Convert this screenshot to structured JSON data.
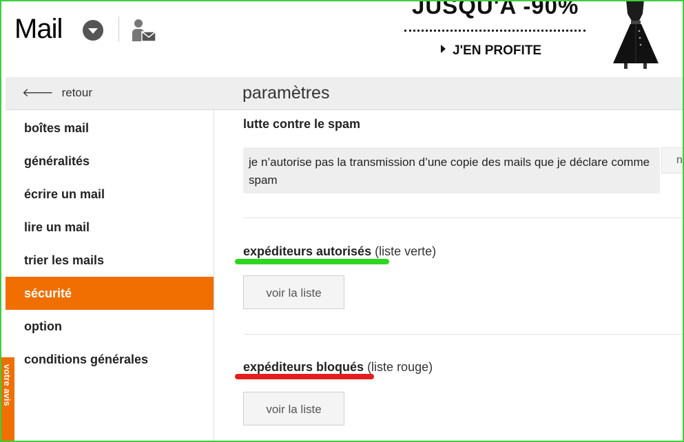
{
  "header": {
    "brand": "Mail",
    "dropdown_icon": "chevron-down-circle-icon",
    "contact_icon": "contacts-mail-icon"
  },
  "ad": {
    "promo": "JUSQU'A -90%",
    "cta": "J'EN PROFITE"
  },
  "toolbar": {
    "back_label": "retour",
    "page_title": "paramètres"
  },
  "sidebar": {
    "items": [
      {
        "label": "boîtes mail",
        "active": false
      },
      {
        "label": "généralités",
        "active": false
      },
      {
        "label": "écrire un mail",
        "active": false
      },
      {
        "label": "lire un mail",
        "active": false
      },
      {
        "label": "trier les mails",
        "active": false
      },
      {
        "label": "sécurité",
        "active": true
      },
      {
        "label": "option",
        "active": false
      },
      {
        "label": "conditions générales",
        "active": false
      }
    ],
    "feedback_tab": "votre avis"
  },
  "content": {
    "section_title": "lutte contre le spam",
    "spam_option_text": "je n’autorise pas la transmission d’une copie des mails que je déclare comme spam",
    "spam_option_side": "n",
    "whitelist": {
      "label": "expéditeurs autorisés",
      "qualifier": "(liste verte)",
      "button": "voir la liste"
    },
    "blacklist": {
      "label": "expéditeurs bloqués",
      "qualifier": "(liste rouge)",
      "button": "voir la liste"
    }
  },
  "colors": {
    "accent": "#f16e00",
    "frame": "#3ccf3c",
    "green_underline": "#2fd61f",
    "red_underline": "#e41e1e"
  }
}
